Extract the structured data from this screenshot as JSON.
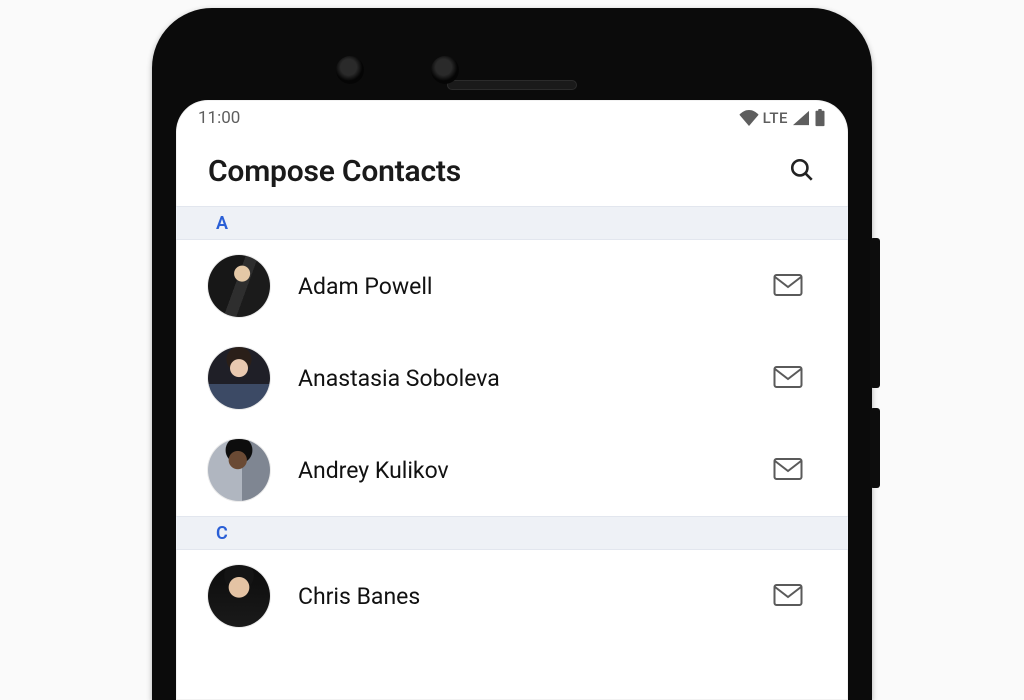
{
  "status": {
    "time": "11:00",
    "network_label": "LTE"
  },
  "appbar": {
    "title": "Compose Contacts"
  },
  "icons": {
    "search": "search-icon",
    "wifi": "wifi-icon",
    "cell": "cell-signal-icon",
    "battery": "battery-icon",
    "mail": "mail-icon"
  },
  "colors": {
    "section_header_bg": "#eef1f6",
    "section_header_text": "#2a5fd6"
  },
  "sections": [
    {
      "letter": "A",
      "contacts": [
        {
          "name": "Adam Powell"
        },
        {
          "name": "Anastasia Soboleva"
        },
        {
          "name": "Andrey Kulikov"
        }
      ]
    },
    {
      "letter": "C",
      "contacts": [
        {
          "name": "Chris Banes"
        }
      ]
    }
  ]
}
